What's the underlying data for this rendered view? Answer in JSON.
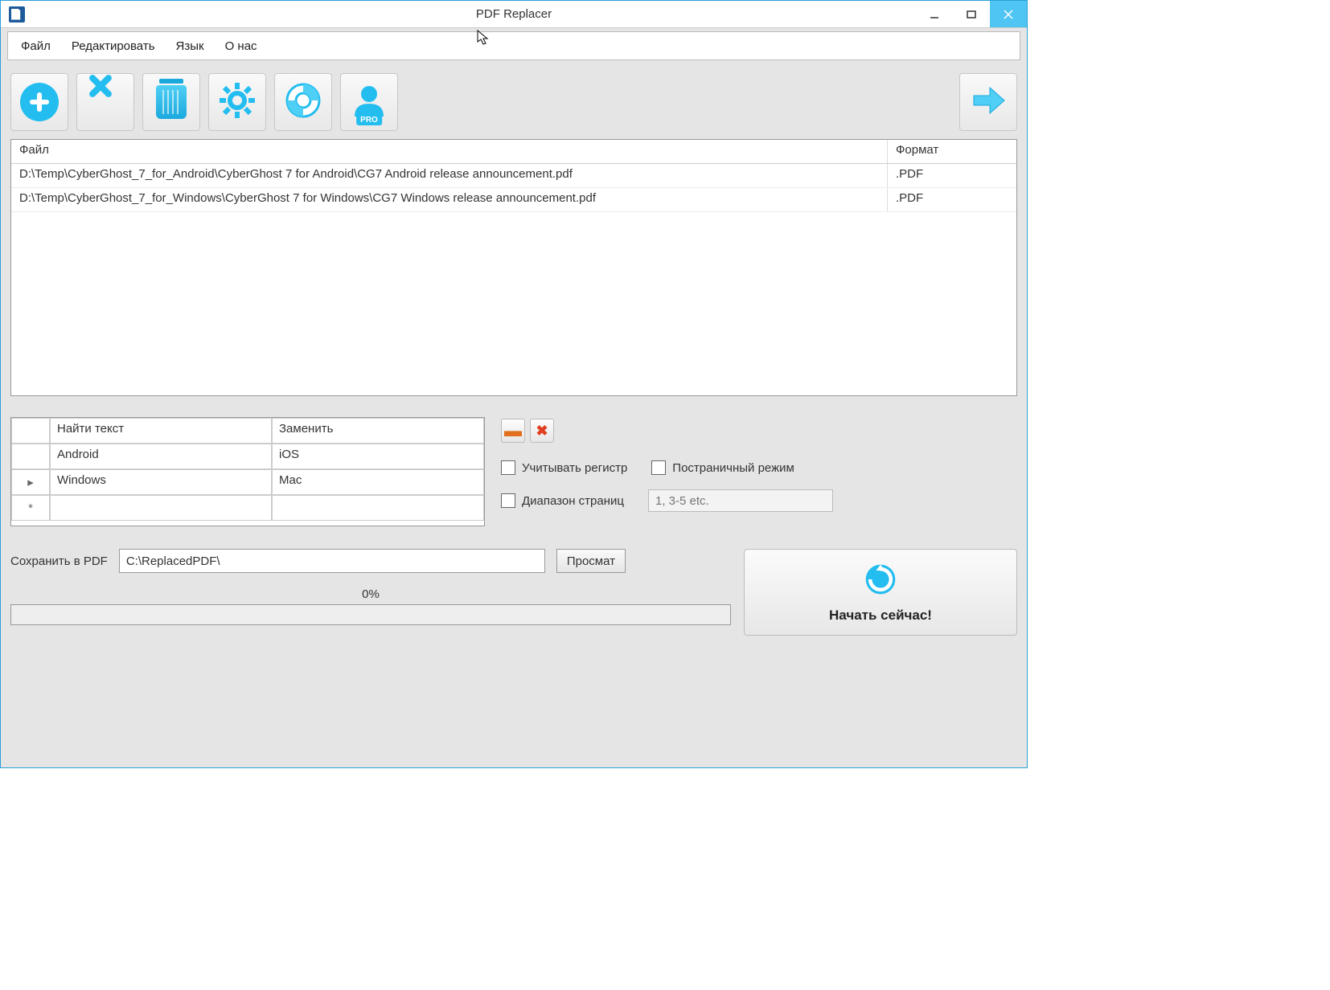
{
  "window": {
    "title": "PDF Replacer"
  },
  "menu": {
    "file": "Файл",
    "edit": "Редактировать",
    "lang": "Язык",
    "about": "О нас"
  },
  "toolbar_icons": {
    "add": "add-icon",
    "remove": "remove-icon",
    "trash": "trash-icon",
    "settings": "settings-icon",
    "help": "help-icon",
    "pro": "pro-icon",
    "go": "go-icon",
    "pro_badge": "PRO"
  },
  "file_table": {
    "columns": {
      "file": "Файл",
      "format": "Формат"
    },
    "rows": [
      {
        "file": "D:\\Temp\\CyberGhost_7_for_Android\\CyberGhost 7 for Android\\CG7 Android release announcement.pdf",
        "format": ".PDF"
      },
      {
        "file": "D:\\Temp\\CyberGhost_7_for_Windows\\CyberGhost 7 for Windows\\CG7 Windows release announcement.pdf",
        "format": ".PDF"
      }
    ]
  },
  "replace_table": {
    "columns": {
      "find": "Найти текст",
      "replace": "Заменить"
    },
    "rows": [
      {
        "marker": "",
        "find": "Android",
        "replace": "iOS"
      },
      {
        "marker": "▸",
        "find": "Windows",
        "replace": "Mac"
      },
      {
        "marker": "*",
        "find": "",
        "replace": ""
      }
    ]
  },
  "options": {
    "case_sensitive": "Учитывать регистр",
    "per_page_mode": "Постраничный режим",
    "page_range": "Диапазон страниц",
    "page_range_placeholder": "1, 3-5 etc."
  },
  "save": {
    "label": "Сохранить в PDF",
    "path": "C:\\ReplacedPDF\\",
    "browse": "Просмат"
  },
  "progress": {
    "label": "0%"
  },
  "start": {
    "label": "Начать сейчас!"
  }
}
